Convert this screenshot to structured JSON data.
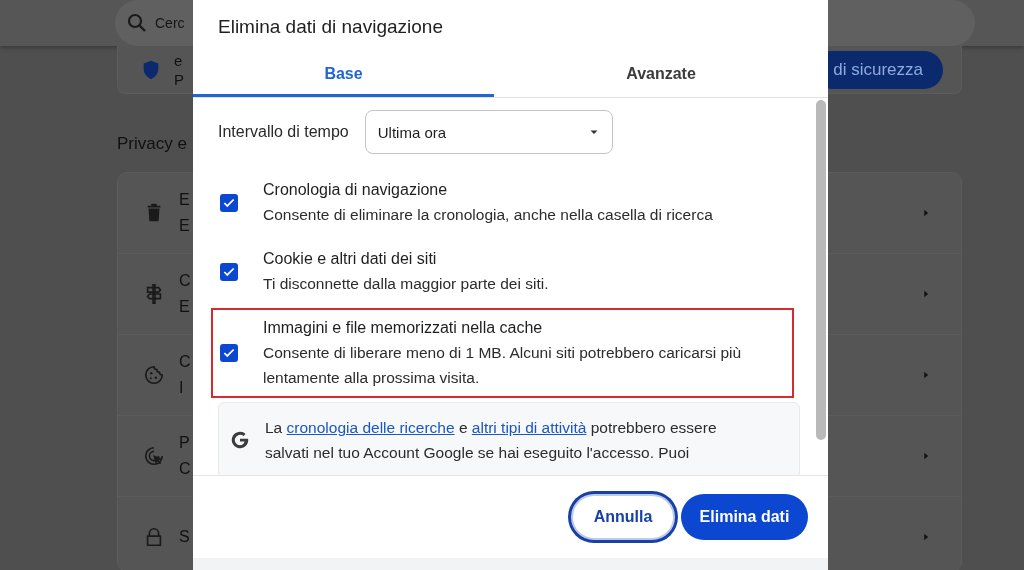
{
  "background": {
    "search": {
      "placeholder": "Cerc"
    },
    "safety_card": {
      "title": "e",
      "subtitle": "P",
      "button": "di sicurezza"
    },
    "section_title": "Privacy e",
    "rows": [
      {
        "title": "E",
        "subtitle": "E"
      },
      {
        "title": "C",
        "subtitle": "E"
      },
      {
        "title": "C",
        "subtitle": "I"
      },
      {
        "title": "P",
        "subtitle": "C"
      },
      {
        "title": "S"
      }
    ]
  },
  "dialog": {
    "title": "Elimina dati di navigazione",
    "tabs": [
      {
        "label": "Base",
        "selected": true
      },
      {
        "label": "Avanzate",
        "selected": false
      }
    ],
    "time_range": {
      "label": "Intervallo di tempo",
      "value": "Ultima ora"
    },
    "options": [
      {
        "title": "Cronologia di navigazione",
        "description": "Consente di eliminare la cronologia, anche nella casella di ricerca",
        "checked": true,
        "highlighted": false
      },
      {
        "title": "Cookie e altri dati dei siti",
        "description": "Ti disconnette dalla maggior parte dei siti.",
        "checked": true,
        "highlighted": false
      },
      {
        "title": "Immagini e file memorizzati nella cache",
        "description": "Consente di liberare meno di 1 MB. Alcuni siti potrebbero caricarsi più lentamente alla prossima visita.",
        "checked": true,
        "highlighted": true
      }
    ],
    "info": {
      "lines": [
        [
          {
            "kind": "text",
            "text": "La "
          },
          {
            "kind": "link",
            "text": "cronologia delle ricerche"
          },
          {
            "kind": "text",
            "text": " e "
          },
          {
            "kind": "link",
            "text": "altri tipi di attività"
          },
          {
            "kind": "text",
            "text": " potrebbero essere"
          }
        ],
        [
          {
            "kind": "text",
            "text": "salvati nel tuo Account Google se hai eseguito l'accesso. Puoi"
          }
        ]
      ]
    },
    "buttons": [
      {
        "label": "Annulla",
        "kind": "secondary"
      },
      {
        "label": "Elimina dati",
        "kind": "primary"
      }
    ]
  }
}
